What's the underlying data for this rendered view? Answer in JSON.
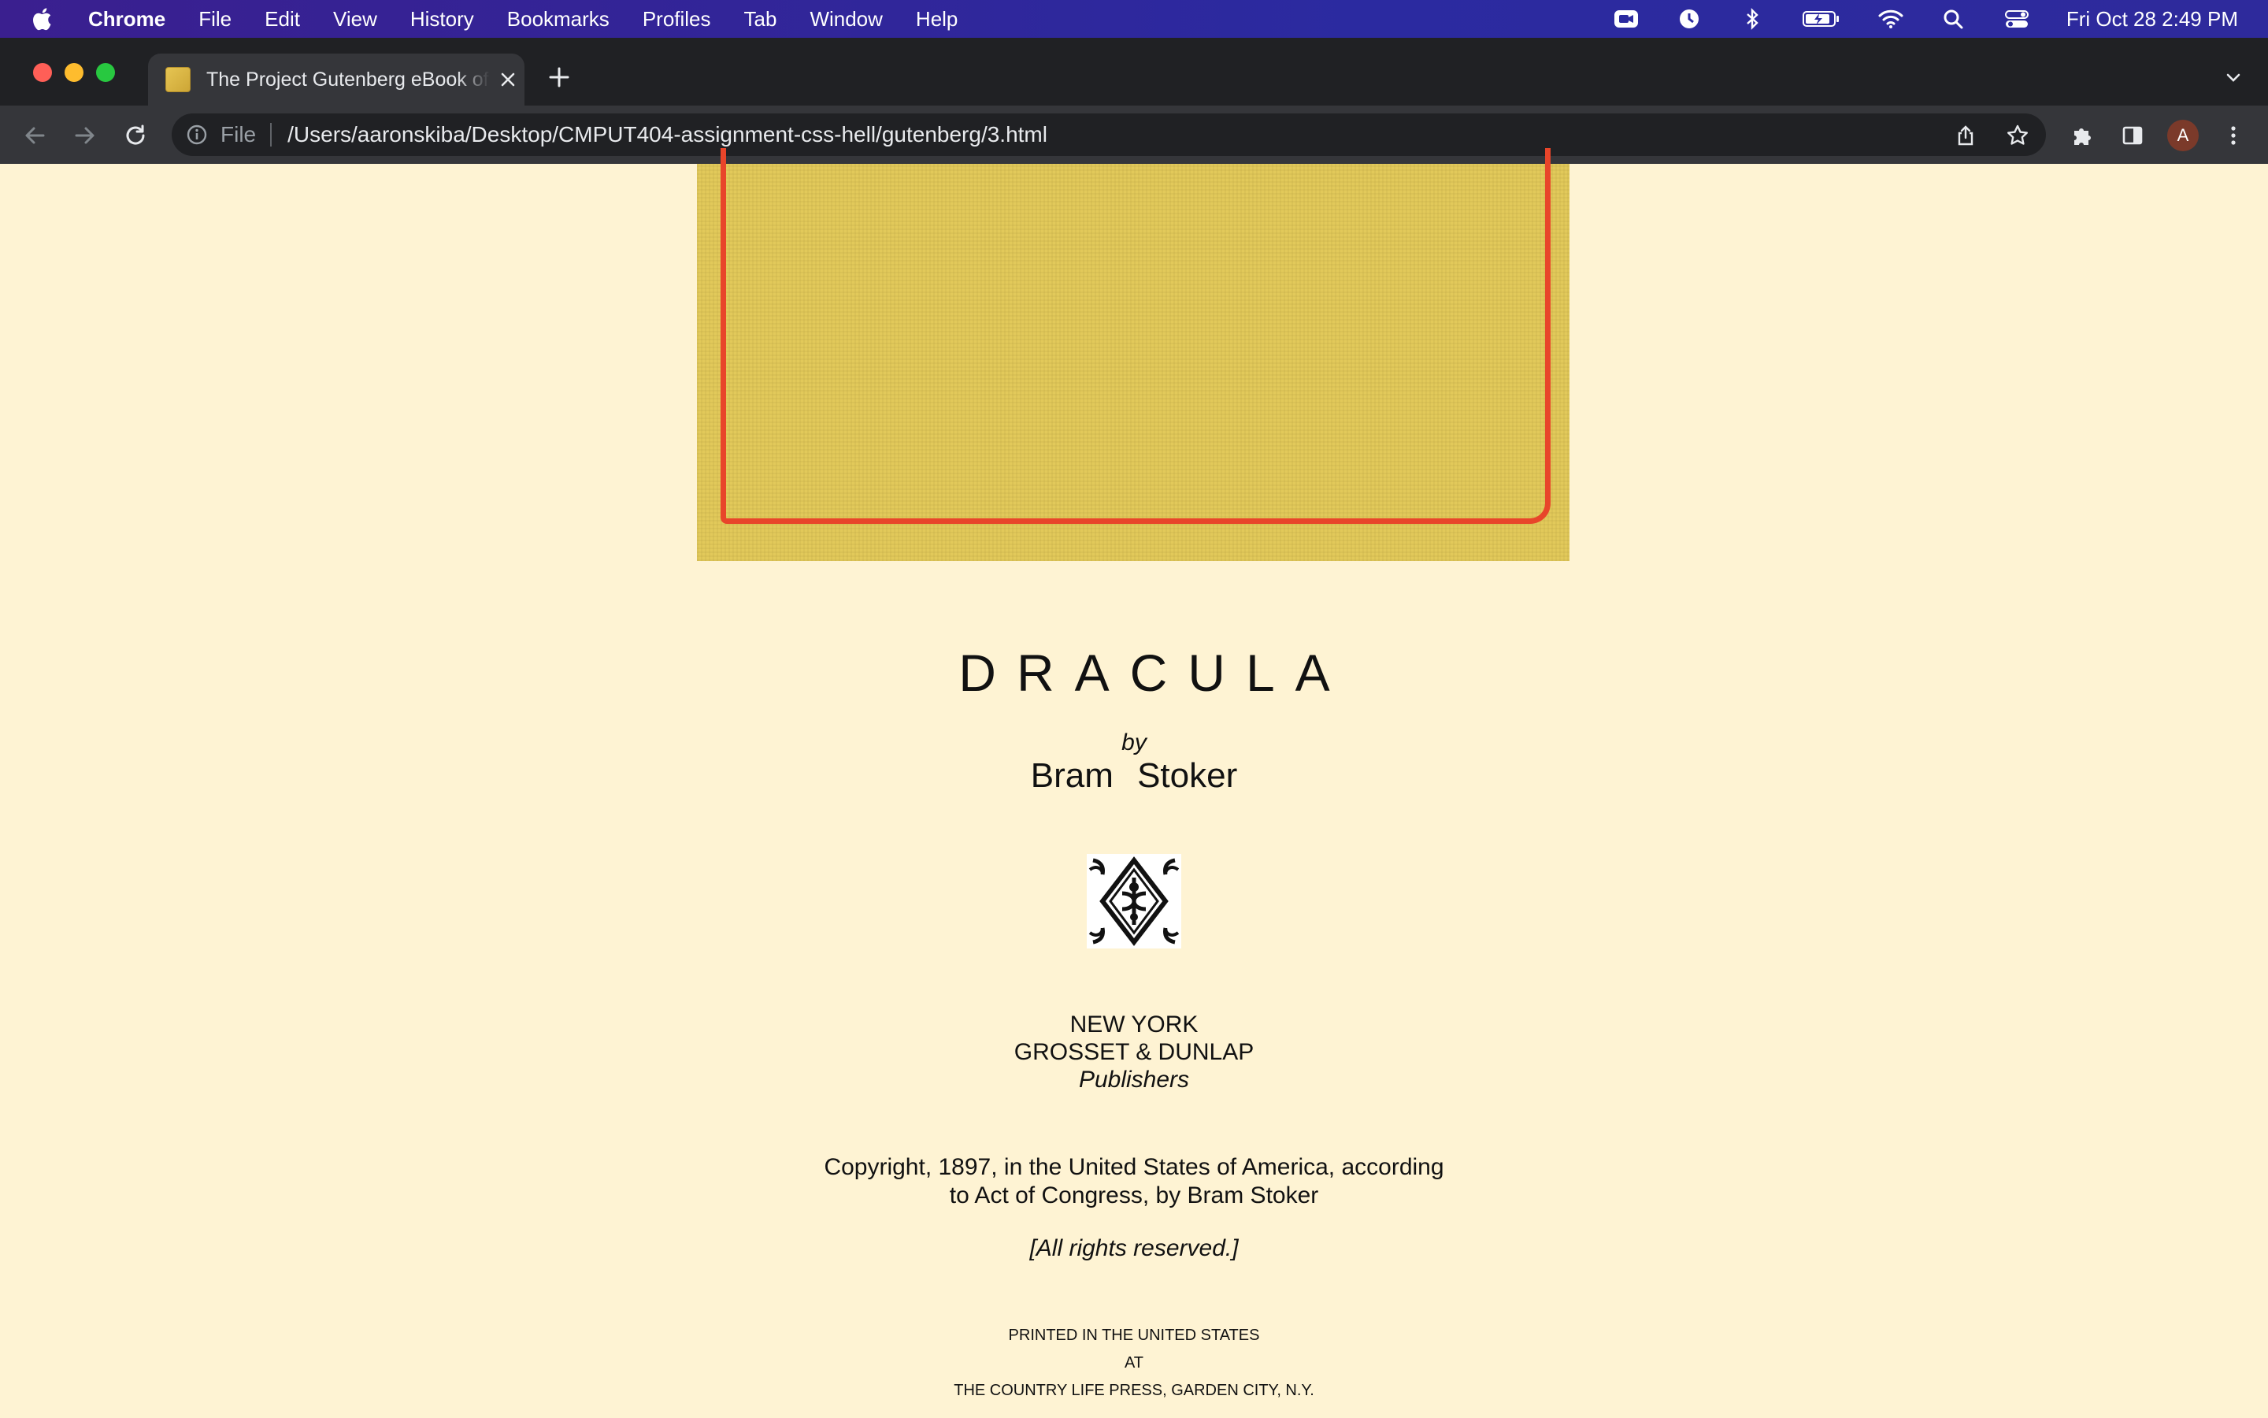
{
  "menubar": {
    "app_name": "Chrome",
    "items": [
      "File",
      "Edit",
      "View",
      "History",
      "Bookmarks",
      "Profiles",
      "Tab",
      "Window",
      "Help"
    ],
    "clock": "Fri Oct 28  2:49 PM",
    "status_icons": [
      "facetime-icon",
      "clock-icon",
      "bluetooth-icon",
      "battery-icon",
      "wifi-icon",
      "spotlight-icon",
      "control-center-icon"
    ]
  },
  "tab": {
    "title": "The Project Gutenberg eBook of Dracula"
  },
  "omnibox": {
    "scheme_label": "File",
    "url": "/Users/aaronskiba/Desktop/CMPUT404-assignment-css-hell/gutenberg/3.html"
  },
  "profile": {
    "initial": "A"
  },
  "colors": {
    "page_background": "#fef3d3",
    "cover_cloth": "#e2c95a",
    "cover_border": "#e8452a"
  },
  "book": {
    "title": "DRACULA",
    "by": "by",
    "author": "Bram Stoker",
    "publisher_city": "NEW YORK",
    "publisher_name": "GROSSET & DUNLAP",
    "publisher_role": "Publishers",
    "copyright_line1": "Copyright, 1897, in the United States of America, according",
    "copyright_line2": "to Act of Congress, by Bram Stoker",
    "rights": "[All rights reserved.]",
    "printed_line1": "PRINTED IN THE UNITED STATES",
    "printed_line2": "AT",
    "printed_line3": "THE COUNTRY LIFE PRESS, GARDEN CITY, N.Y."
  }
}
